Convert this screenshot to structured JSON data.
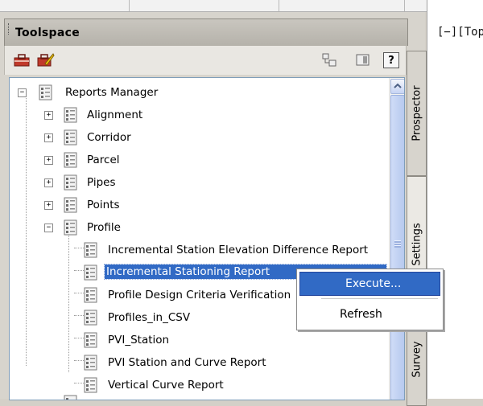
{
  "panel": {
    "title": "Toolspace"
  },
  "toolbar": {
    "left_icons": [
      "toolbox-icon",
      "toolbox-edit-icon"
    ],
    "right_icons": [
      "item-view-icon",
      "panel-toggle-icon",
      "help-icon"
    ],
    "help_label": "?"
  },
  "tree": {
    "root": "Reports Manager",
    "items": [
      {
        "label": "Alignment",
        "state": "collapsed"
      },
      {
        "label": "Corridor",
        "state": "collapsed"
      },
      {
        "label": "Parcel",
        "state": "collapsed"
      },
      {
        "label": "Pipes",
        "state": "collapsed"
      },
      {
        "label": "Points",
        "state": "collapsed"
      },
      {
        "label": "Profile",
        "state": "expanded"
      }
    ],
    "profile_reports": [
      "Incremental Station Elevation Difference Report",
      "Incremental Stationing Report",
      "Profile Design Criteria Verification",
      "Profiles_in_CSV",
      "PVI_Station",
      "PVI Station and Curve Report",
      "Vertical Curve Report"
    ],
    "selected": "Incremental Stationing Report"
  },
  "tabs": [
    "Prospector",
    "Settings",
    "Survey"
  ],
  "context_menu": {
    "items": [
      "Execute...",
      "Refresh"
    ],
    "highlighted": "Execute..."
  },
  "drawing": {
    "viewport_label": "[−][Top"
  }
}
